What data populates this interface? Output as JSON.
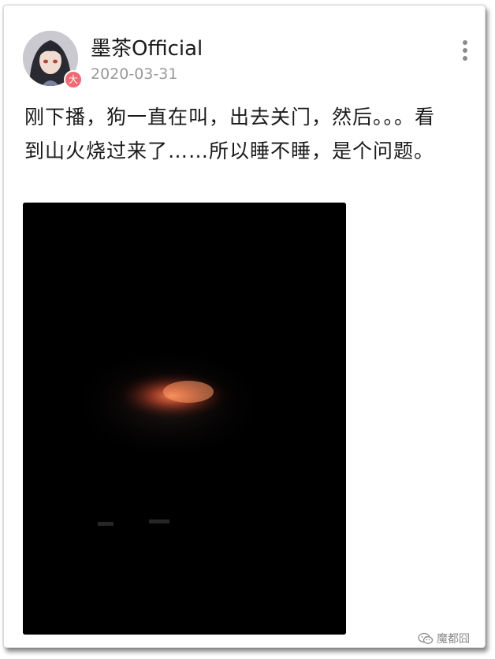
{
  "post": {
    "username": "墨茶Official",
    "date": "2020-03-31",
    "level_badge": "大",
    "text": "刚下播，狗一直在叫，出去关门，然后。。。看到山火烧过来了……所以睡不睡，是个问题。"
  },
  "icons": {
    "more": "more-vertical-icon",
    "watermark": "wechat-icon"
  },
  "watermark": {
    "label": "魔都囧"
  },
  "colors": {
    "text": "#1a1a1a",
    "meta": "#9a9a9a",
    "badge": "#ef6b73",
    "video_bg": "#000000"
  }
}
